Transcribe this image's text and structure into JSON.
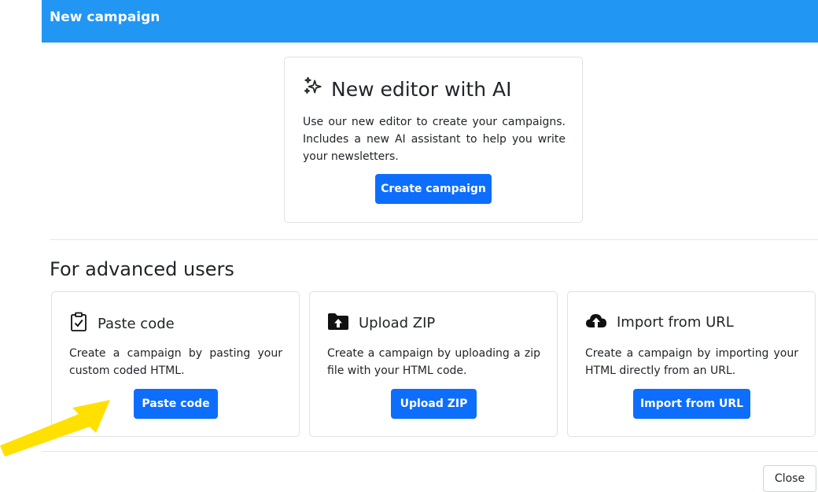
{
  "header": {
    "title": "New campaign"
  },
  "ai_editor": {
    "title": "New editor with AI",
    "icon": "sparkles-icon",
    "description": "Use our new editor to create your campaigns. Includes a new AI assistant to help you write your newsletters.",
    "button_label": "Create campaign"
  },
  "advanced": {
    "heading": "For advanced users",
    "options": [
      {
        "title": "Paste code",
        "icon": "clipboard-check-icon",
        "description": "Create a campaign by pasting your custom coded HTML.",
        "button_label": "Paste code"
      },
      {
        "title": "Upload ZIP",
        "icon": "folder-upload-icon",
        "description": "Create a campaign by uploading a zip file with your HTML code.",
        "button_label": "Upload ZIP"
      },
      {
        "title": "Import from URL",
        "icon": "cloud-upload-icon",
        "description": "Create a campaign by importing your HTML directly from an URL.",
        "button_label": "Import from URL"
      }
    ]
  },
  "footer": {
    "close_label": "Close"
  },
  "colors": {
    "header": "#2196f3",
    "primary_button": "#0d6efd",
    "annotation_arrow": "#ffe000"
  }
}
